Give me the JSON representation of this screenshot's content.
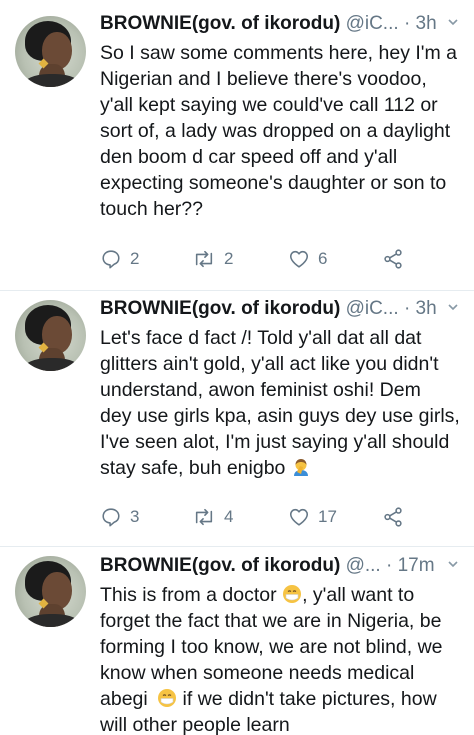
{
  "tweets": [
    {
      "name": "BROWNIE(gov. of ikorodu)",
      "handle": "@iC...",
      "time": "· 3h",
      "lines": [
        "So I saw some comments here, hey I'm a",
        "Nigerian and I believe there's voodoo,",
        "y'all kept saying we could've call 112 or",
        "sort of, a lady was dropped on a daylight",
        "den boom d car speed off and y'all",
        "expecting someone's daughter or son to",
        "touch her??"
      ],
      "replies": "2",
      "retweets": "2",
      "likes": "6"
    },
    {
      "name": "BROWNIE(gov. of ikorodu)",
      "handle": "@iC...",
      "time": "· 3h",
      "lines": [
        "Let's face d fact /! Told y'all dat all dat",
        "glitters ain't gold, y'all act like you didn't",
        "understand, awon feminist oshi! Dem",
        "dey use girls kpa, asin guys dey use girls,",
        "I've seen alot, I'm just saying y'all should",
        "stay safe, buh enigbo"
      ],
      "replies": "3",
      "retweets": "4",
      "likes": "17"
    },
    {
      "name": "BROWNIE(gov. of ikorodu)",
      "handle": "@...",
      "time": "· 17m",
      "lines": [
        "This is from a doctor",
        ", y'all want to",
        "forget the fact that we are in Nigeria, be",
        "forming I too know, we are not blind, we",
        "know when someone needs medical",
        "abegi",
        " if we didn't take pictures, how",
        "will other people learn"
      ]
    }
  ],
  "icons": {
    "reply": "reply-icon",
    "retweet": "retweet-icon",
    "like": "heart-icon",
    "share": "share-icon",
    "caret": "chevron-down-icon"
  },
  "colors": {
    "text": "#14171a",
    "secondary": "#657786",
    "divider": "#e6ecf0"
  }
}
